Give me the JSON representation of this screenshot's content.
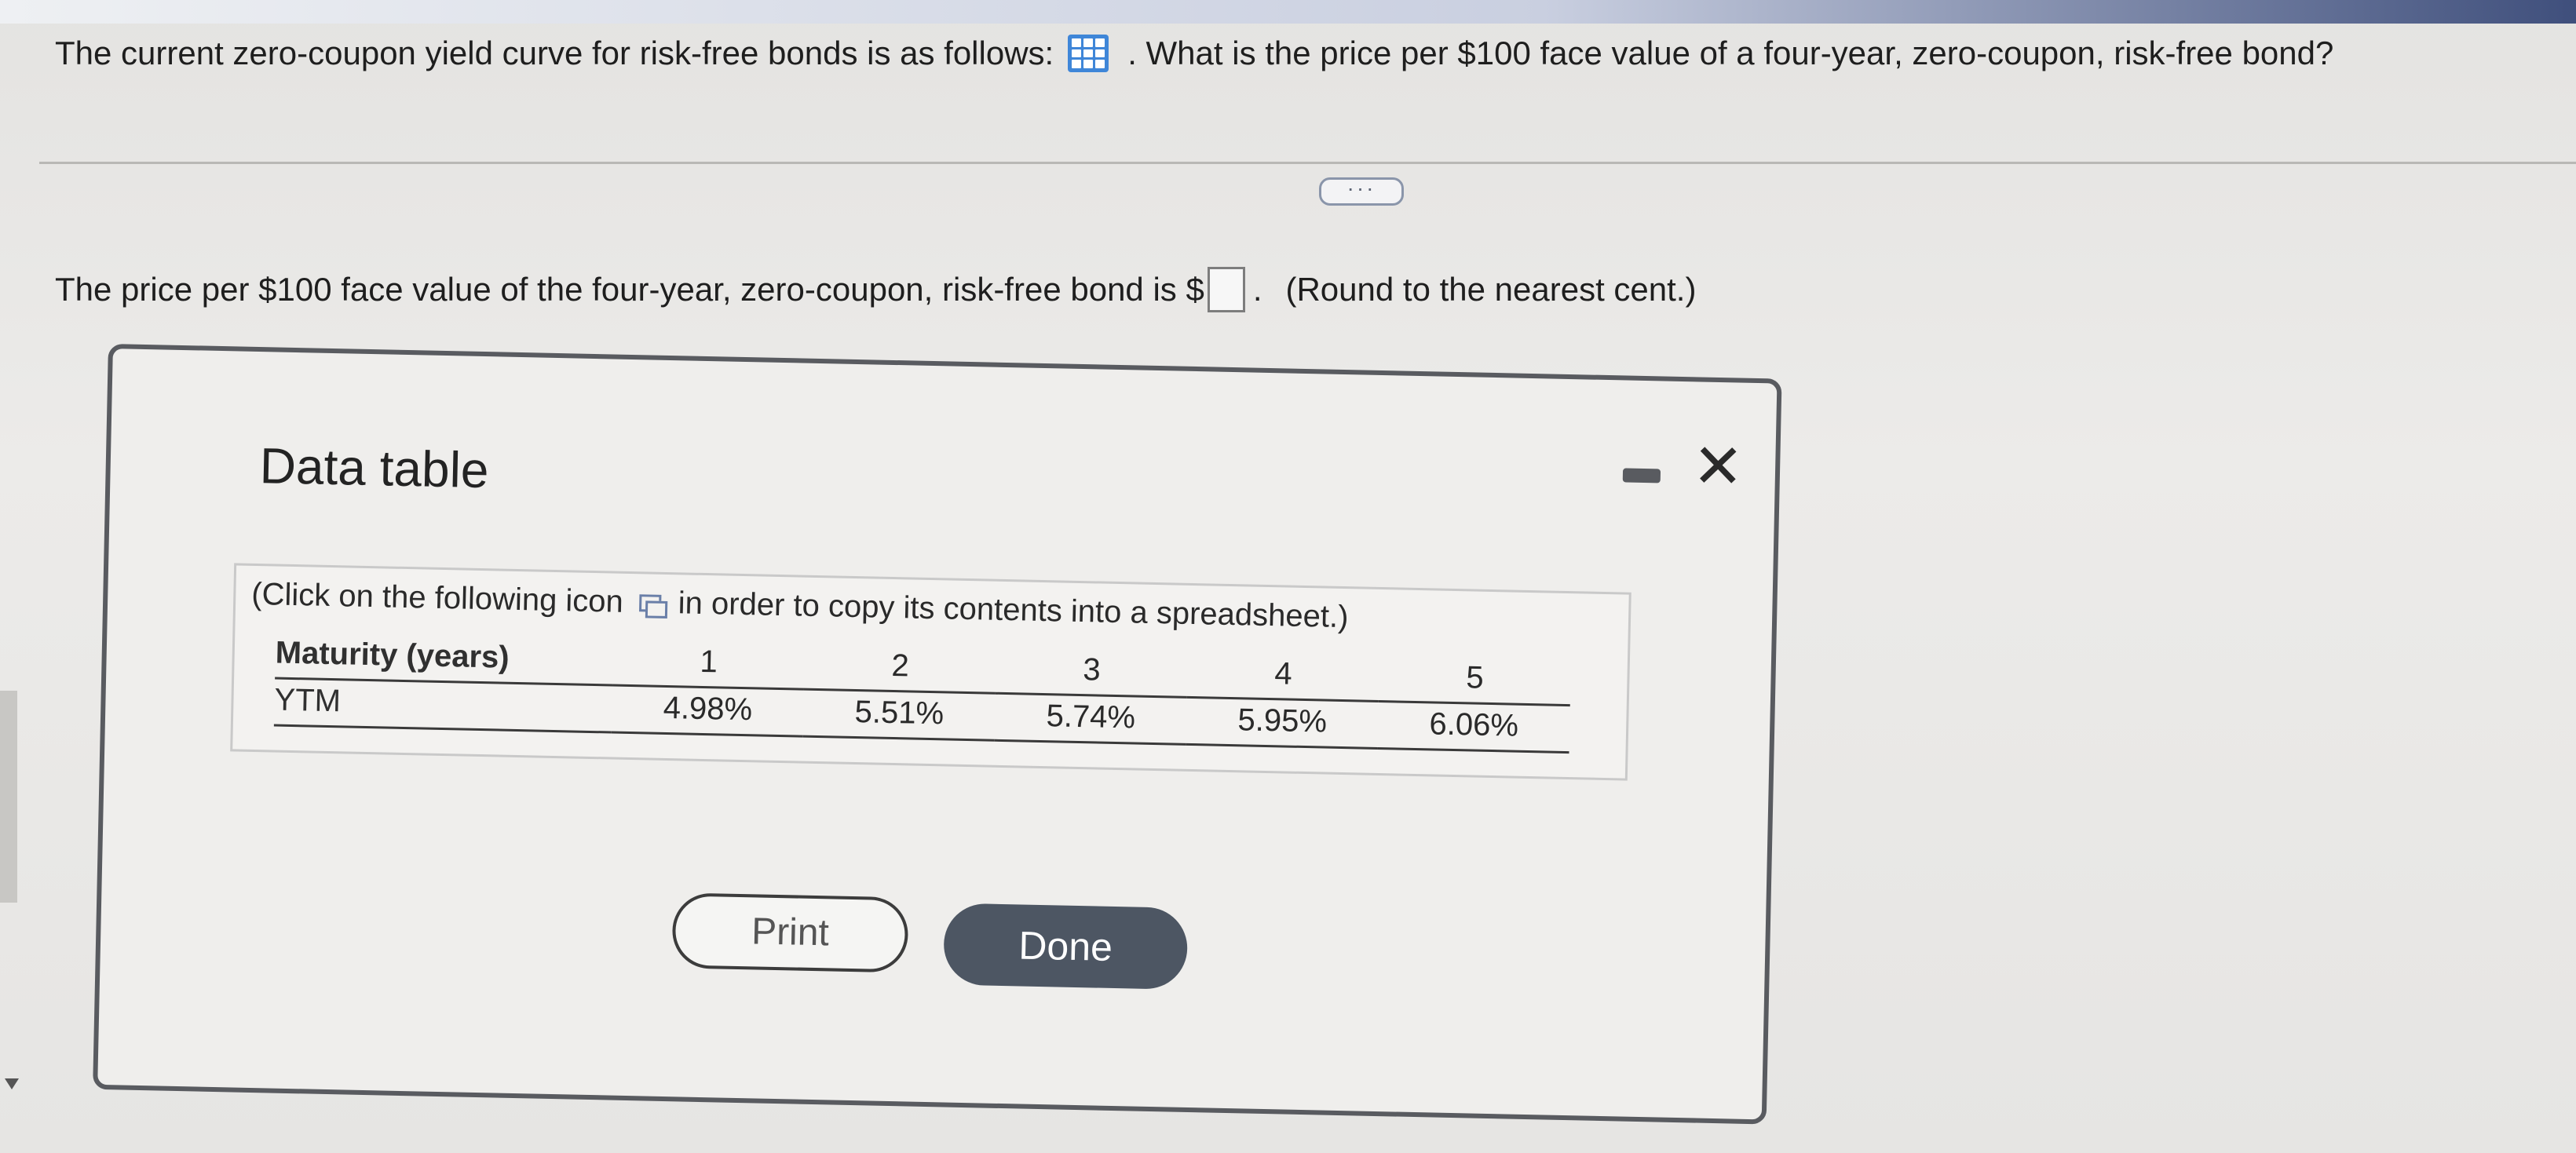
{
  "question": {
    "prefix": "The current zero-coupon yield curve for risk-free bonds is as follows:",
    "suffix": ". What is the price per $100 face value of a four-year, zero-coupon, risk-free bond?"
  },
  "more_button": "···",
  "answer": {
    "prefix": "The price per $100 face value of the four-year, zero-coupon, risk-free bond is $",
    "suffix": ".",
    "note": "(Round to the nearest cent.)",
    "input_value": ""
  },
  "dialog": {
    "title": "Data table",
    "copy_note_prefix": "(Click on the following icon",
    "copy_note_suffix": "in order to copy its contents into a spreadsheet.)",
    "table": {
      "row1_label": "Maturity (years)",
      "row2_label": "YTM",
      "maturities": [
        "1",
        "2",
        "3",
        "4",
        "5"
      ],
      "ytm": [
        "4.98%",
        "5.51%",
        "5.74%",
        "5.95%",
        "6.06%"
      ]
    },
    "print_label": "Print",
    "done_label": "Done"
  },
  "icons": {
    "data_table": "grid-table-icon",
    "copy": "copy-icon",
    "minimize": "minimize-icon",
    "close": "close-icon"
  },
  "colors": {
    "accent_blue": "#3f86d8",
    "done_button": "#4d5663",
    "dialog_border": "#595b60"
  }
}
